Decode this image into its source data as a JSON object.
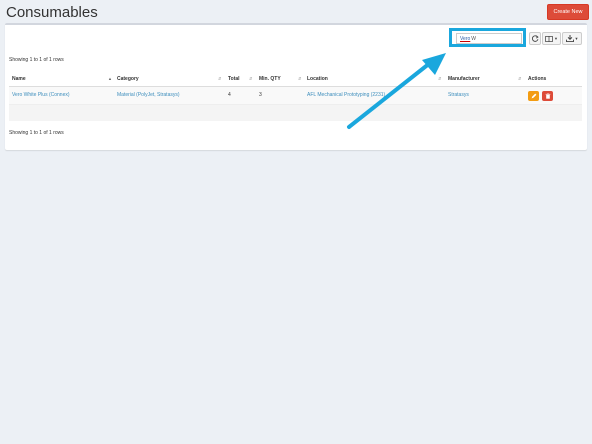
{
  "header": {
    "title": "Consumables",
    "create_label": "Create New"
  },
  "toolbar": {
    "search_typed": "Vero",
    "search_rest": "W",
    "refresh_icon": "refresh-icon",
    "columns_icon": "columns-icon",
    "export_icon": "download-icon"
  },
  "pagination": {
    "top": "Showing 1 to 1 of 1 rows",
    "bottom": "Showing 1 to 1 of 1 rows"
  },
  "table": {
    "headers": [
      "Name",
      "Category",
      "Total",
      "Min. QTY",
      "Location",
      "Manufacturer",
      "Actions"
    ],
    "rows": [
      {
        "name": "Vero White Plus (Connex)",
        "category": "Material (PolyJet, Stratasys)",
        "total": "4",
        "min_qty": "3",
        "location": "AFL Mechanical Prototyping (2231)",
        "manufacturer": "Stratasys"
      }
    ]
  },
  "colors": {
    "accent": "#1aa7dd",
    "danger": "#dd4b39",
    "warning": "#f39c12",
    "link": "#3c8dbc"
  }
}
